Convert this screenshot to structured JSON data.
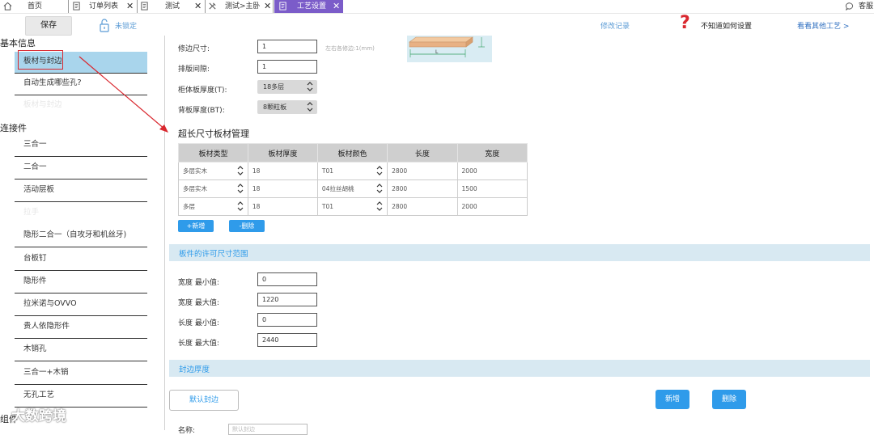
{
  "tabs": [
    {
      "label": "首页",
      "icon": "home-icon",
      "closable": false
    },
    {
      "label": "订单列表",
      "icon": "document-icon",
      "closable": true
    },
    {
      "label": "测试",
      "icon": "document-icon",
      "closable": true
    },
    {
      "label": "测试>主卧",
      "icon": "tools-icon",
      "closable": true
    },
    {
      "label": "工艺设置",
      "icon": "document-icon",
      "closable": true,
      "active": true
    },
    {
      "label": "客服",
      "icon": "chat-icon",
      "closable": false
    }
  ],
  "toolbar": {
    "save_label": "保存",
    "lock_label": "未锁定",
    "modify_record": "修改记录",
    "help_label": "不知道如何设置",
    "see_other": "看看其他工艺 >"
  },
  "sidebar": {
    "section_basic": "基本信息",
    "basic_items": [
      {
        "label": "板材与封边",
        "selected": true
      },
      {
        "label": "自动生成哪些孔?"
      },
      {
        "label": "板材与封边",
        "faded": true
      }
    ],
    "section_connectors": "连接件",
    "connector_items": [
      {
        "label": "三合一"
      },
      {
        "label": "二合一"
      },
      {
        "label": "活动层板"
      },
      {
        "label": "拉手",
        "faded": true
      },
      {
        "label": "隐形二合一（自攻牙和机丝牙)"
      },
      {
        "label": "台板钉"
      },
      {
        "label": "隐形件"
      },
      {
        "label": "拉米诺与OVVO"
      },
      {
        "label": "贵人依隐形件"
      },
      {
        "label": "木销孔"
      },
      {
        "label": "三合一+木销"
      },
      {
        "label": "无孔工艺"
      }
    ],
    "section_groups": "组件"
  },
  "form": {
    "trim_label": "修边尺寸:",
    "trim_value": "1",
    "trim_hint": "左右各修边:1(mm)",
    "gap_label": "排版间隙:",
    "gap_value": "1",
    "cabinet_thickness_label": "柜体板厚度(T):",
    "cabinet_thickness_value": "18多层",
    "back_thickness_label": "背板厚度(BT):",
    "back_thickness_value": "8颗粒板",
    "diagram_label": "L"
  },
  "oversize": {
    "title": "超长尺寸板材管理",
    "columns": [
      "板材类型",
      "板材厚度",
      "板材颜色",
      "长度",
      "宽度"
    ],
    "rows": [
      {
        "type": "多层实木",
        "thickness": "18",
        "color": "T01",
        "length": "2800",
        "width": "2000"
      },
      {
        "type": "多层实木",
        "thickness": "18",
        "color": "04拉丝胡桃",
        "length": "2800",
        "width": "1500"
      },
      {
        "type": "多层",
        "thickness": "18",
        "color": "T01",
        "length": "2800",
        "width": "2000"
      }
    ],
    "add_label": "+新增",
    "delete_label": "-删除"
  },
  "range": {
    "title": "板件的许可尺寸范围",
    "fields": [
      {
        "label": "宽度 最小值:",
        "value": "0"
      },
      {
        "label": "宽度 最大值:",
        "value": "1220"
      },
      {
        "label": "长度 最小值:",
        "value": "0"
      },
      {
        "label": "长度 最大值:",
        "value": "2440"
      }
    ]
  },
  "edge": {
    "title": "封边厚度",
    "default_label": "默认封边",
    "add_label": "新增",
    "delete_label": "删除",
    "bottom_label": "名称:",
    "bottom_placeholder": "默认封边"
  },
  "watermark": "大数跨境",
  "colors": {
    "accent_blue": "#2f9bea",
    "active_tab": "#7b5cc9",
    "selected_item": "#a9d5ec",
    "band_bg": "#d8e9f2",
    "annotation_red": "#d9282f"
  }
}
